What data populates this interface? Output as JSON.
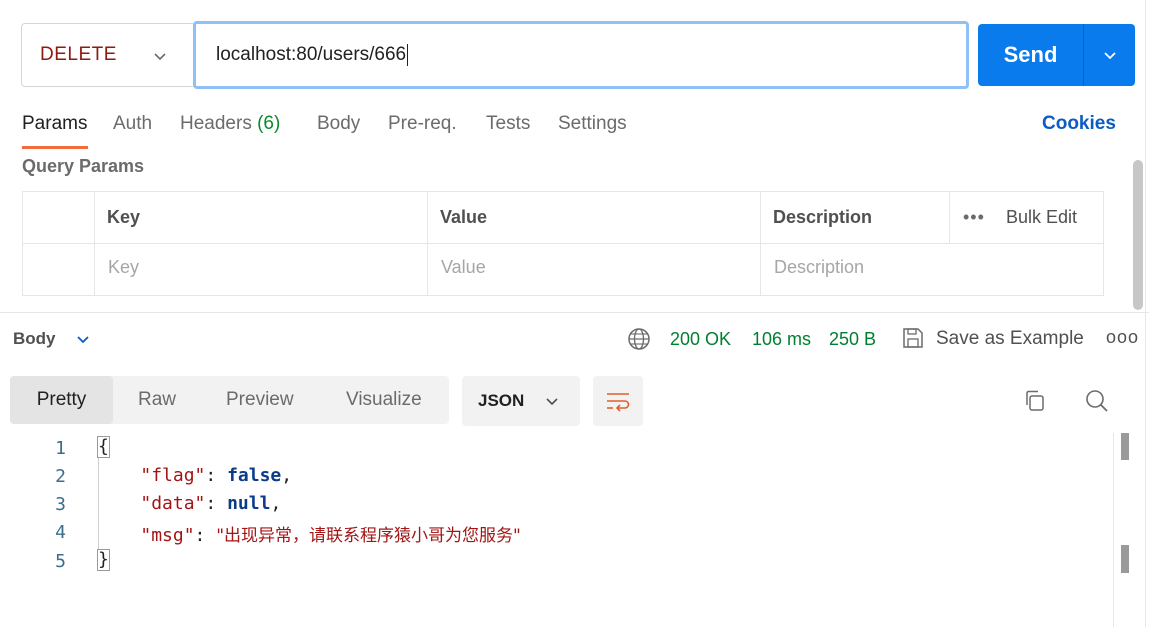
{
  "request": {
    "method": "DELETE",
    "url": "localhost:80/users/666",
    "send_label": "Send"
  },
  "tabs": [
    {
      "label": "Params",
      "active": true
    },
    {
      "label": "Auth"
    },
    {
      "label": "Headers",
      "count": "(6)"
    },
    {
      "label": "Body"
    },
    {
      "label": "Pre-req."
    },
    {
      "label": "Tests"
    },
    {
      "label": "Settings"
    }
  ],
  "cookies_label": "Cookies",
  "query_params": {
    "title": "Query Params",
    "headers": [
      "Key",
      "Value",
      "Description"
    ],
    "placeholders": [
      "Key",
      "Value",
      "Description"
    ],
    "bulk_edit_label": "Bulk Edit",
    "more_glyph": "•••"
  },
  "response": {
    "body_label": "Body",
    "status": "200 OK",
    "time": "106 ms",
    "size": "250 B",
    "save_label": "Save as Example",
    "more_glyph": "ooo",
    "view_tabs": [
      "Pretty",
      "Raw",
      "Preview",
      "Visualize"
    ],
    "format": "JSON",
    "lines": [
      "1",
      "2",
      "3",
      "4",
      "5"
    ],
    "code": {
      "open": "{",
      "k1": "\"flag\"",
      "v1": "false",
      "k2": "\"data\"",
      "v2": "null",
      "k3": "\"msg\"",
      "v3": "\"出现异常，请联系程序猿小哥为您服务\"",
      "close": "}"
    }
  },
  "colors": {
    "accent": "#097bed",
    "method": "#8e1a10",
    "status_ok": "#007f31",
    "tab_underline": "#f26b3a"
  }
}
